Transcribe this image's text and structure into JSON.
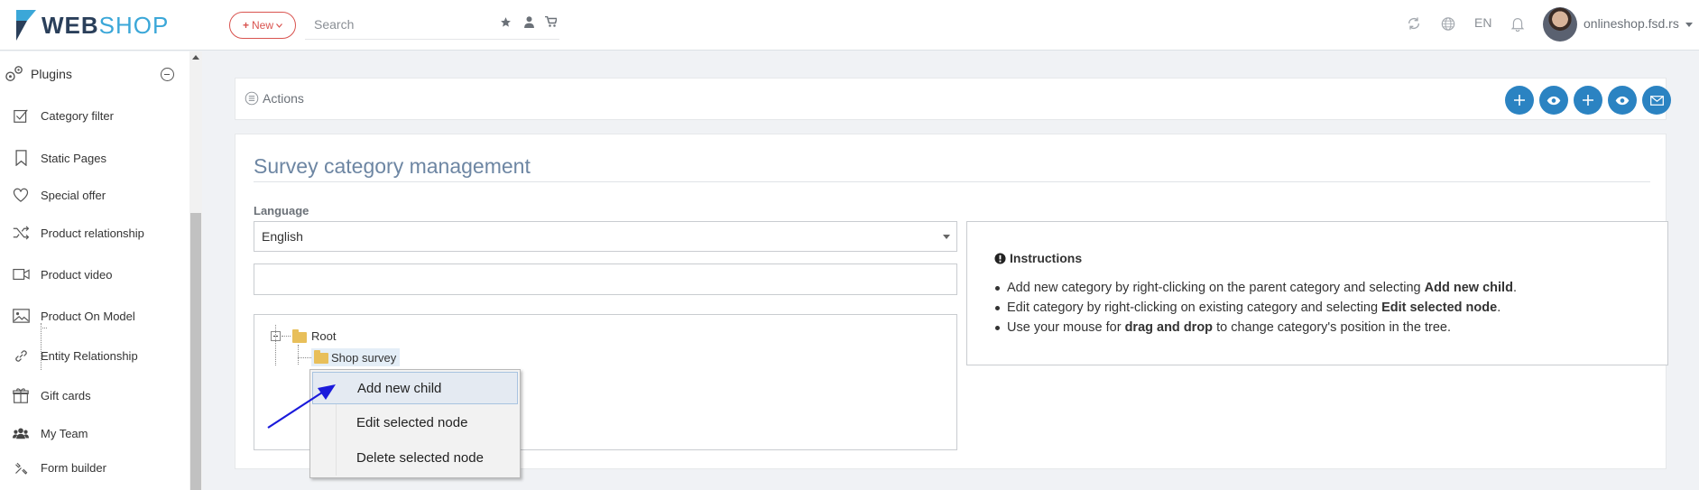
{
  "header": {
    "logo_web": "WEB",
    "logo_shop": "SHOP",
    "new_label": "New",
    "search_placeholder": "Search",
    "language": "EN",
    "username": "onlineshop.fsd.rs"
  },
  "sidebar": {
    "section_title": "Plugins",
    "items": [
      {
        "label": "Category filter",
        "icon": "checkbox-icon"
      },
      {
        "label": "Static Pages",
        "icon": "bookmark-icon"
      },
      {
        "label": "Special offer",
        "icon": "heart-icon"
      },
      {
        "label": "Product relationship",
        "icon": "shuffle-icon"
      },
      {
        "label": "Product video",
        "icon": "video-icon"
      },
      {
        "label": "Product On Model",
        "icon": "image-icon"
      },
      {
        "label": "Entity Relationship",
        "icon": "link-icon"
      },
      {
        "label": "Gift cards",
        "icon": "gift-icon"
      },
      {
        "label": "My Team",
        "icon": "users-icon"
      },
      {
        "label": "Form builder",
        "icon": "tools-icon"
      }
    ]
  },
  "actions": {
    "label": "Actions"
  },
  "panel": {
    "title": "Survey category management",
    "language_label": "Language",
    "language_value": "English",
    "filter_value": ""
  },
  "tree": {
    "root": "Root",
    "child": "Shop survey"
  },
  "instructions": {
    "title": "Instructions",
    "line1_pre": "Add new category by right-clicking on the parent category and selecting ",
    "line1_bold": "Add new child",
    "line1_post": ".",
    "line2_pre": "Edit category by right-clicking on existing category and selecting ",
    "line2_bold": "Edit selected node",
    "line2_post": ".",
    "line3_pre": "Use your mouse for ",
    "line3_bold": "drag and drop",
    "line3_post": " to change category's position in the tree."
  },
  "context_menu": {
    "items": [
      "Add new child",
      "Edit selected node",
      "Delete selected node"
    ]
  },
  "colors": {
    "accent": "#2b83c2",
    "brand_dark": "#2a3f5a",
    "brand_light": "#3ba7d8",
    "new_button": "#d9534f",
    "annotation_arrow": "#1a1adb"
  }
}
